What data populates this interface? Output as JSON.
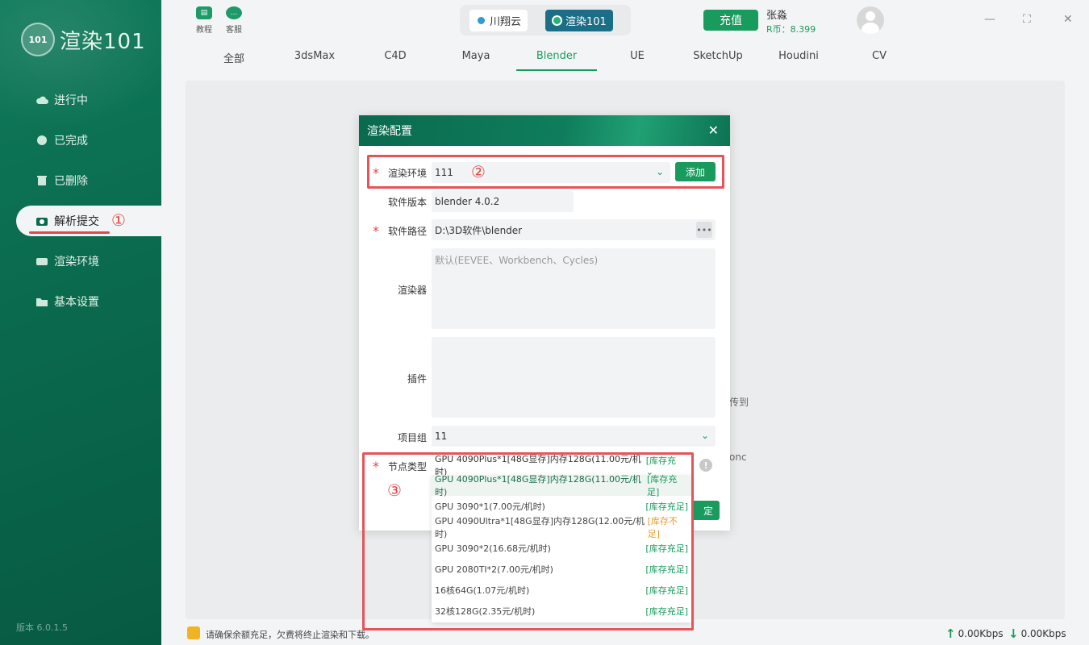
{
  "sidebar": {
    "logo_badge": "101",
    "logo_text": "渲染101",
    "items": [
      {
        "label": "进行中"
      },
      {
        "label": "已完成"
      },
      {
        "label": "已删除"
      },
      {
        "label": "解析提交"
      },
      {
        "label": "渲染环境"
      },
      {
        "label": "基本设置"
      }
    ],
    "version": "版本 6.0.1.5"
  },
  "topbar": {
    "tutorial": "教程",
    "service": "客服",
    "switch_a": "川翔云",
    "switch_b": "渲染101",
    "recharge": "充值",
    "username": "张淼",
    "coins": "R币：8.399",
    "tabs": [
      "全部",
      "3dsMax",
      "C4D",
      "Maya",
      "Blender",
      "UE",
      "SketchUp",
      "Houdini",
      "CV"
    ]
  },
  "background_fragments": {
    "frag1": "传到",
    "frag2": "onc"
  },
  "modal": {
    "title": "渲染配置",
    "env_label": "渲染环境",
    "env_value": "111",
    "add_label": "添加",
    "version_label": "软件版本",
    "version_value": "blender 4.0.2",
    "path_label": "软件路径",
    "path_value": "D:\\3D软件\\blender",
    "renderer_label": "渲染器",
    "renderer_placeholder": "默认(EEVEE、Workbench、Cycles)",
    "plugin_label": "插件",
    "project_label": "项目组",
    "project_value": "11",
    "node_label": "节点类型",
    "node_value": "GPU 4090Plus*1[48G显存]内存128G(11.00元/机时)",
    "node_value_status": "[库存充",
    "confirm_fragment": "定"
  },
  "dropdown": {
    "options": [
      {
        "name": "GPU 4090Plus*1[48G显存]内存128G(11.00元/机时)",
        "status": "[库存充足]",
        "low": false
      },
      {
        "name": "GPU 3090*1(7.00元/机时)",
        "status": "[库存充足]",
        "low": false
      },
      {
        "name": "GPU 4090Ultra*1[48G显存]内存128G(12.00元/机时)",
        "status": "[库存不足]",
        "low": true
      },
      {
        "name": "GPU 3090*2(16.68元/机时)",
        "status": "[库存充足]",
        "low": false
      },
      {
        "name": "GPU 2080TI*2(7.00元/机时)",
        "status": "[库存充足]",
        "low": false
      },
      {
        "name": "16核64G(1.07元/机时)",
        "status": "[库存充足]",
        "low": false
      },
      {
        "name": "32核128G(2.35元/机时)",
        "status": "[库存充足]",
        "low": false
      }
    ]
  },
  "annotations": {
    "n1": "①",
    "n2": "②",
    "n3": "③",
    "color": "#e4545a"
  },
  "statusbar": {
    "warning": "请确保余额充足，欠费将终止渲染和下载。",
    "upload": "0.00Kbps",
    "download": "0.00Kbps"
  },
  "colors": {
    "brand_green": "#1a9b5e",
    "sidebar_dark": "#0a6a4d",
    "stock_low": "#e89a2b"
  }
}
